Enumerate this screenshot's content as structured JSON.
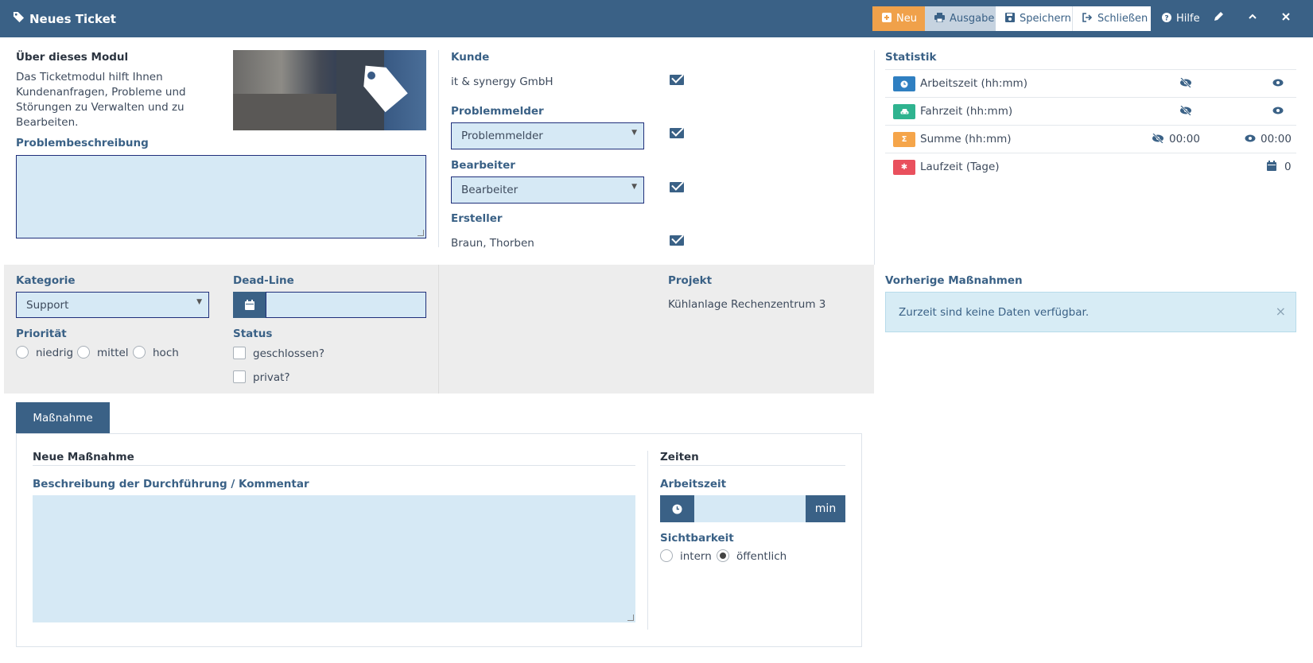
{
  "window": {
    "title": "Neues Ticket",
    "toolbar": {
      "neu": "Neu",
      "ausgabe": "Ausgabe",
      "speichern": "Speichern",
      "schliessen": "Schließen",
      "hilfe": "Hilfe"
    }
  },
  "about": {
    "heading": "Über dieses Modul",
    "text_lines": [
      "Das Ticketmodul hilft Ihnen",
      "Kundenanfragen, Probleme und",
      "Störungen zu Verwalten und zu",
      "Bearbeiten."
    ]
  },
  "problem": {
    "label": "Problembeschreibung",
    "value": ""
  },
  "contacts": {
    "kunde_label": "Kunde",
    "kunde_value": "it & synergy GmbH",
    "problemmelder_label": "Problemmelder",
    "problemmelder_value": "Problemmelder",
    "bearbeiter_label": "Bearbeiter",
    "bearbeiter_value": "Bearbeiter",
    "ersteller_label": "Ersteller",
    "ersteller_value": "Braun, Thorben"
  },
  "statistik": {
    "heading": "Statistik",
    "rows": [
      {
        "label": "Arbeitszeit (hh:mm)",
        "color": "#2f7fc1",
        "icon": "clock-icon",
        "hidden_value": "",
        "visible_value": ""
      },
      {
        "label": "Fahrzeit (hh:mm)",
        "color": "#2fb38f",
        "icon": "car-icon",
        "hidden_value": "",
        "visible_value": ""
      },
      {
        "label": "Summe (hh:mm)",
        "color": "#f5a54a",
        "icon": "sigma-icon",
        "hidden_value": "00:00",
        "visible_value": "00:00"
      },
      {
        "label": "Laufzeit (Tage)",
        "color": "#e9505d",
        "icon": "gear-icon",
        "hidden_value": "",
        "visible_value": "0"
      }
    ]
  },
  "details": {
    "kategorie_label": "Kategorie",
    "kategorie_value": "Support",
    "deadline_label": "Dead-Line",
    "deadline_value": "",
    "projekt_label": "Projekt",
    "projekt_value": "Kühlanlage Rechenzentrum 3",
    "prioritaet_label": "Priorität",
    "prioritaet_options": [
      "niedrig",
      "mittel",
      "hoch"
    ],
    "status_label": "Status",
    "status_options": [
      "geschlossen?",
      "privat?"
    ]
  },
  "vorherige": {
    "heading": "Vorherige Maßnahmen",
    "message": "Zurzeit sind keine Daten verfügbar."
  },
  "massnahme": {
    "tab_label": "Maßnahme",
    "section_title": "Neue Maßnahme",
    "beschreibung_label": "Beschreibung der Durchführung / Kommentar",
    "beschreibung_value": "",
    "zeiten_title": "Zeiten",
    "arbeitszeit_label": "Arbeitszeit",
    "arbeitszeit_value": "",
    "arbeitszeit_unit": "min",
    "sichtbarkeit_label": "Sichtbarkeit",
    "sichtbarkeit_options": [
      "intern",
      "öffentlich"
    ],
    "sichtbarkeit_selected": "öffentlich"
  }
}
